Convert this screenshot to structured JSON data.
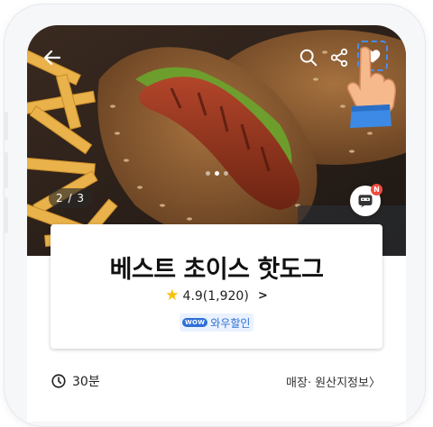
{
  "screen": {
    "page_counter": "2 / 3",
    "carousel_total": 3,
    "carousel_active_index": 2
  },
  "product": {
    "title": "베스트 초이스 핫도그",
    "rating": "4.9",
    "review_count": "(1,920)",
    "promo_badge": "WOW",
    "promo_label": "와우할인"
  },
  "delivery": {
    "time": "30분",
    "store_info": "매장· 원산지정보"
  },
  "chat": {
    "badge": "N"
  },
  "icons": {
    "back": "arrow-left-icon",
    "search": "search-icon",
    "share": "share-icon",
    "favorite": "heart-icon",
    "clock": "clock-icon",
    "chat": "chat-icon",
    "pointer": "pointer-hand-icon"
  },
  "colors": {
    "accent_blue": "#2f6fd6",
    "star_yellow": "#f6c10b",
    "badge_red": "#f14b3f"
  }
}
